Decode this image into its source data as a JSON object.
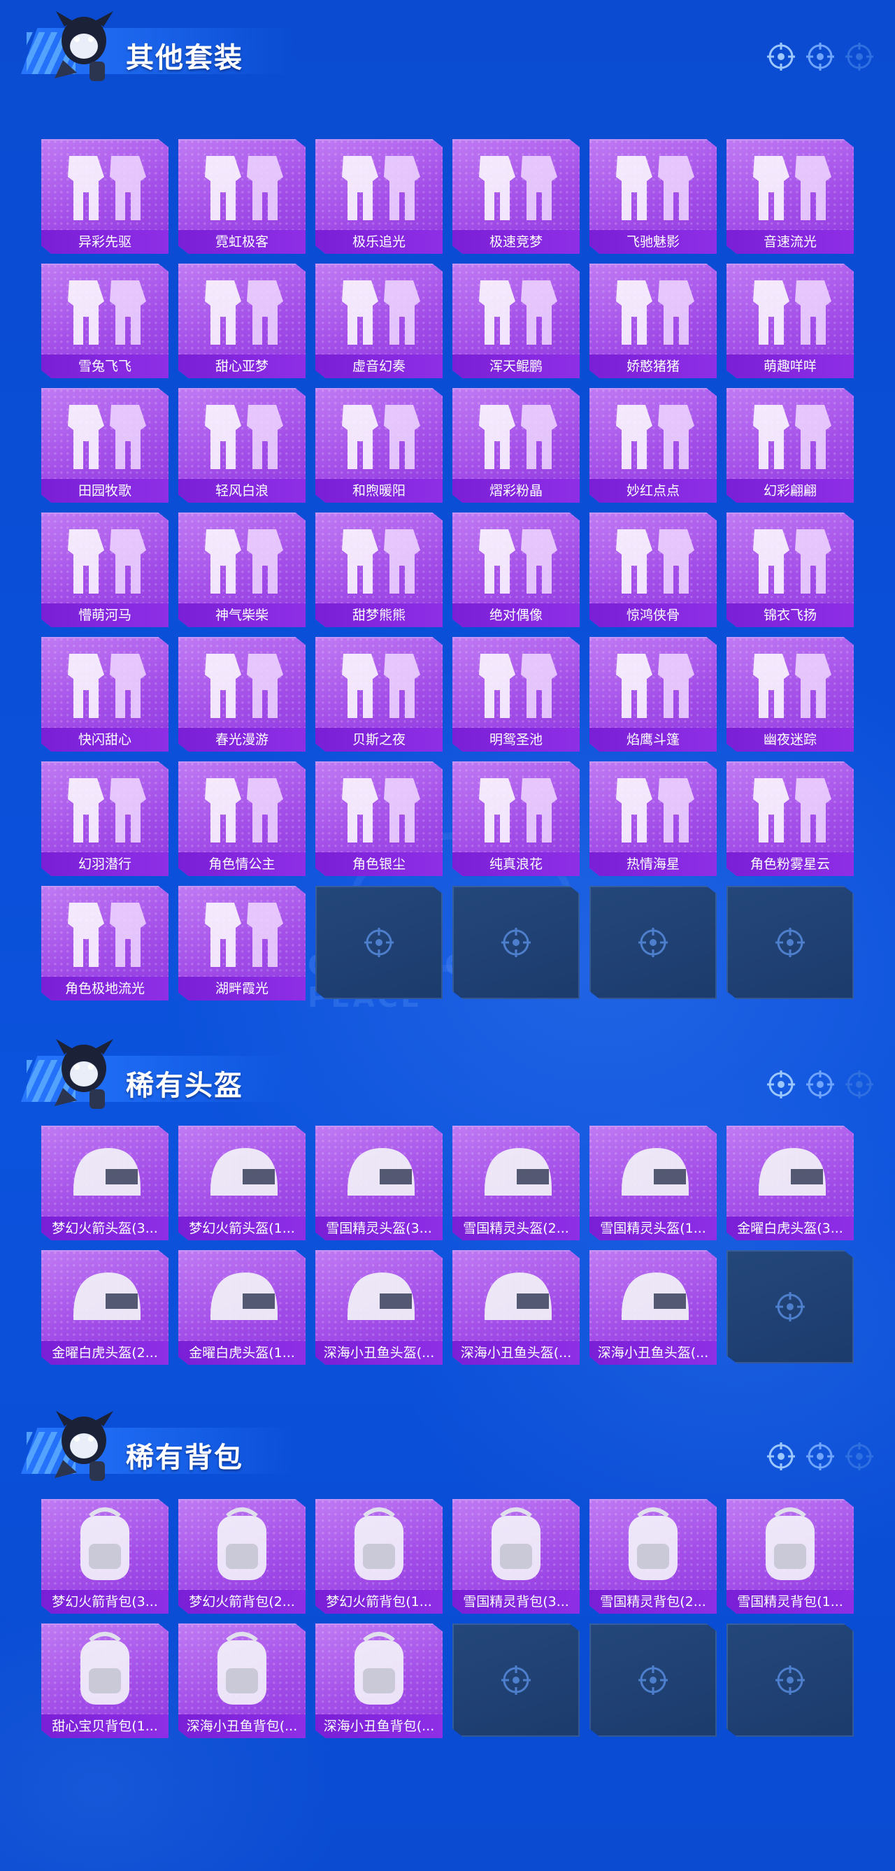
{
  "sections": [
    {
      "title": "其他套装",
      "items": [
        "异彩先驱",
        "霓虹极客",
        "极乐追光",
        "极速竞梦",
        "飞驰魅影",
        "音速流光",
        "雪兔飞飞",
        "甜心亚梦",
        "虚音幻奏",
        "浑天鲲鹏",
        "娇憨猪猪",
        "萌趣咩咩",
        "田园牧歌",
        "轻风白浪",
        "和煦暖阳",
        "熠彩粉晶",
        "妙红点点",
        "幻彩翩翩",
        "懵萌河马",
        "神气柴柴",
        "甜梦熊熊",
        "绝对偶像",
        "惊鸿侠骨",
        "锦衣飞扬",
        "快闪甜心",
        "春光漫游",
        "贝斯之夜",
        "明鸳圣池",
        "焰鹰斗篷",
        "幽夜迷踪",
        "幻羽潜行",
        "角色情公主",
        "角色银尘",
        "纯真浪花",
        "热情海星",
        "角色粉雾星云",
        "角色极地流光",
        "湖畔霞光"
      ],
      "empty_slots": 4
    },
    {
      "title": "稀有头盔",
      "items": [
        "梦幻火箭头盔(3...",
        "梦幻火箭头盔(1...",
        "雪国精灵头盔(3...",
        "雪国精灵头盔(2...",
        "雪国精灵头盔(1...",
        "金曜白虎头盔(3...",
        "金曜白虎头盔(2...",
        "金曜白虎头盔(1...",
        "深海小丑鱼头盔(...",
        "深海小丑鱼头盔(...",
        "深海小丑鱼头盔(..."
      ],
      "empty_slots": 1
    },
    {
      "title": "稀有背包",
      "items": [
        "梦幻火箭背包(3...",
        "梦幻火箭背包(2...",
        "梦幻火箭背包(1...",
        "雪国精灵背包(3...",
        "雪国精灵背包(2...",
        "雪国精灵背包(1...",
        "甜心宝贝背包(1...",
        "深海小丑鱼背包(...",
        "深海小丑鱼背包(..."
      ],
      "empty_slots": 3
    }
  ],
  "watermark": "GAME FOR PEACE",
  "colors": {
    "background": "#0a4fd8",
    "card": "#a34ee8",
    "label_bar": "#7a1fd6",
    "empty_slot": "#1c3b6d"
  }
}
